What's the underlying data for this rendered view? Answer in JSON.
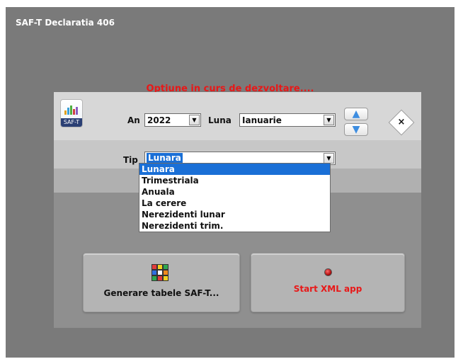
{
  "window": {
    "title": "SAF-T Declaratia 406"
  },
  "notice": "Optiune in curs de dezvoltare....",
  "logo": {
    "text": "SAF-T"
  },
  "form": {
    "an_label": "An",
    "an_value": "2022",
    "luna_label": "Luna",
    "luna_value": "Ianuarie",
    "tip_label": "Tip",
    "tip_value": "Lunara"
  },
  "tip_options": [
    "Lunara",
    "Trimestriala",
    "Anuala",
    "La cerere",
    "Nerezidenti lunar",
    "Nerezidenti trim."
  ],
  "tip_selected_index": 0,
  "buttons": {
    "generate": "Generare tabele SAF-T...",
    "start_xml": "Start XML app",
    "close_glyph": "×",
    "up_glyph": "▲",
    "down_glyph": "▼"
  },
  "icons": {
    "dropdown": "chevron-down-icon",
    "close": "close-icon",
    "up": "arrow-up-icon",
    "down": "arrow-down-icon"
  },
  "colors": {
    "accent_red": "#e81818",
    "selection_blue": "#1a6fd6",
    "window_bg": "#7a7a7a"
  }
}
